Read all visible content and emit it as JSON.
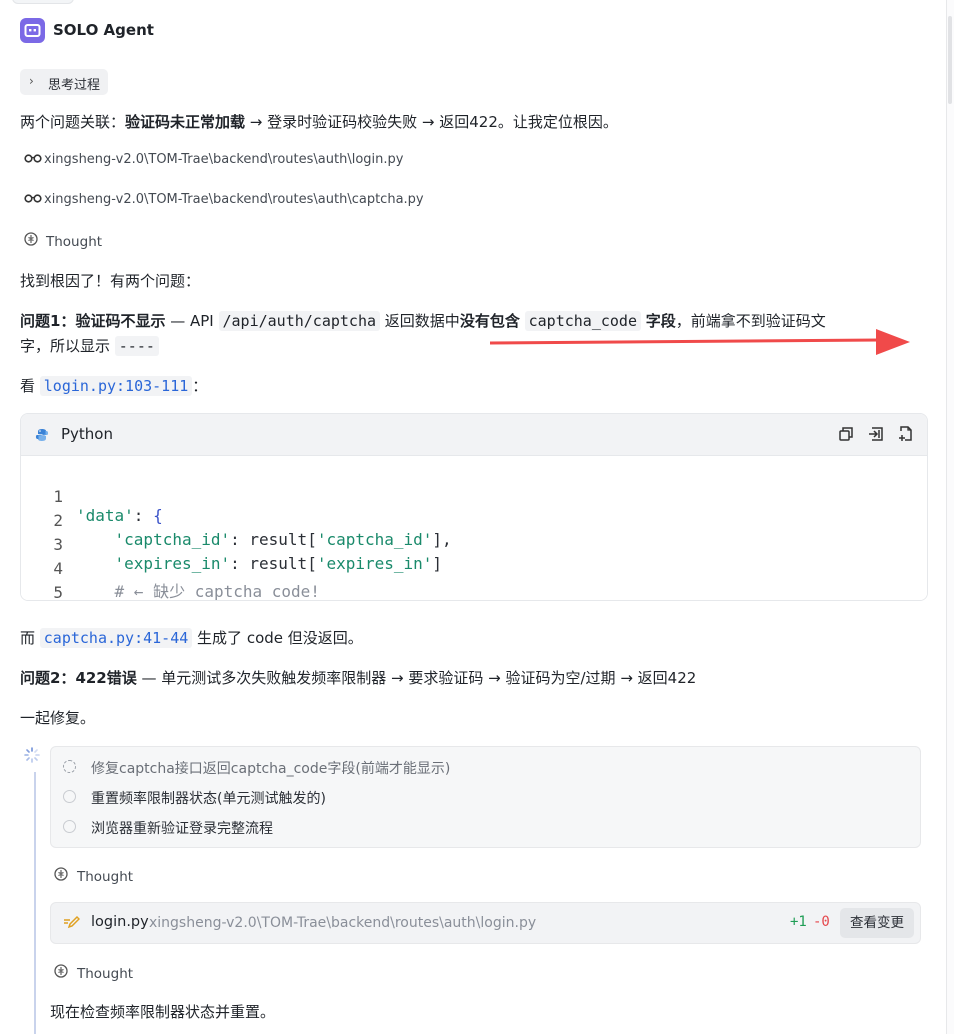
{
  "agent": {
    "name": "SOLO Agent"
  },
  "think_toggle": {
    "label": "思考过程"
  },
  "intro": {
    "pre": "两个问题关联：",
    "bold": "验证码未正常加载",
    "post": " → 登录时验证码校验失败 → 返回422。让我定位根因。"
  },
  "reads": [
    {
      "path": "xingsheng-v2.0\\TOM-Trae\\backend\\routes\\auth\\login.py"
    },
    {
      "path": "xingsheng-v2.0\\TOM-Trae\\backend\\routes\\auth\\captcha.py"
    }
  ],
  "thought_label": "Thought",
  "found": "找到根因了！有两个问题：",
  "problem1": {
    "label": "问题1：",
    "title": "验证码不显示",
    "dash": " — API ",
    "api": "/api/auth/captcha",
    "mid": " 返回数据中",
    "bold2": "没有包含",
    "field": "captcha_code",
    "bold3": "字段",
    "tail": "，前端拿不到验证码文",
    "line2": "字，所以显示 ",
    "placeholder": "----"
  },
  "see": {
    "pre": "看 ",
    "ref": "login.py:103-111",
    "post": "："
  },
  "code": {
    "language": "Python",
    "lines": [
      {
        "n": "1",
        "a": "'data'",
        "b": ": ",
        "c": "{"
      },
      {
        "n": "2",
        "a": "'captcha_id'",
        "b": ": result[",
        "c": "'captcha_id'",
        "d": "],",
        "indent": "    "
      },
      {
        "n": "3",
        "a": "'expires_in'",
        "b": ": result[",
        "c": "'expires_in'",
        "d": "]",
        "indent": "    "
      },
      {
        "n": "4",
        "comment": "# ← 缺少 captcha_code!",
        "indent": "    "
      },
      {
        "n": "5",
        "c": "}",
        "d": ","
      }
    ]
  },
  "captcha_note": {
    "pre": "而 ",
    "ref": "captcha.py:41-44",
    "post": " 生成了 code 但没返回。"
  },
  "problem2": {
    "label": "问题2：",
    "title": "422错误",
    "rest": " — 单元测试多次失败触发频率限制器 → 要求验证码 → 验证码为空/过期 → 返回422"
  },
  "fix_together": "一起修复。",
  "todos": [
    {
      "text": "修复captcha接口返回captcha_code字段(前端才能显示)",
      "status": "in-progress"
    },
    {
      "text": "重置频率限制器状态(单元测试触发的)",
      "status": "pending"
    },
    {
      "text": "浏览器重新验证登录完整流程",
      "status": "pending"
    }
  ],
  "edit": {
    "filename": "login.py",
    "path": "xingsheng-v2.0\\TOM-Trae\\backend\\routes\\auth\\login.py",
    "added": "+1",
    "removed": "-0",
    "view_label": "查看变更"
  },
  "last_line": "现在检查频率限制器状态并重置。",
  "colors": {
    "accent": "#7b69e6",
    "added": "#1f9d55",
    "removed": "#e5484d",
    "arrow": "#f04a4a",
    "link": "#2a66d8"
  }
}
